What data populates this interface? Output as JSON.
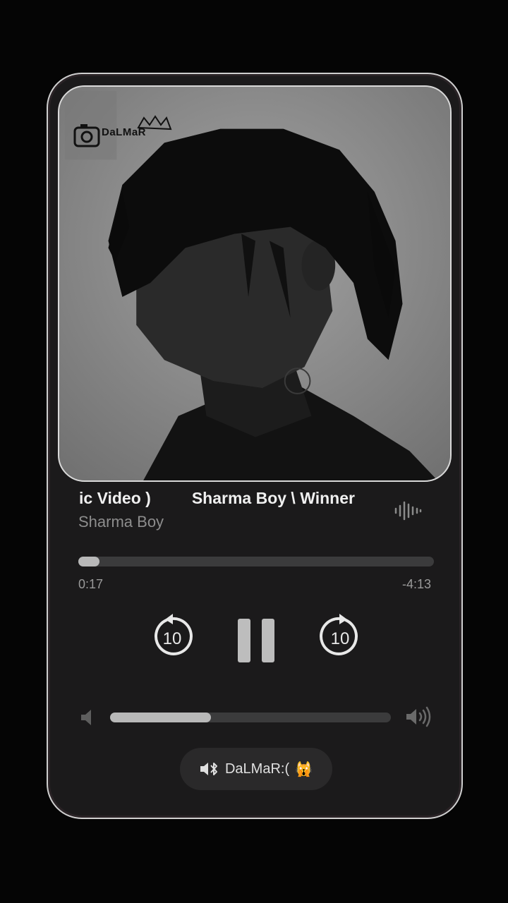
{
  "artwork": {
    "watermark": "DaLMaR"
  },
  "track": {
    "title_part1": "ic Video )",
    "title_part2": "Sharma Boy \\ Winner",
    "artist": "Sharma Boy"
  },
  "progress": {
    "elapsed": "0:17",
    "remaining": "-4:13",
    "fraction": 0.06
  },
  "controls": {
    "skip_back": "10",
    "skip_forward": "10"
  },
  "volume": {
    "level": 0.36
  },
  "output_device": {
    "label": "DaLMaR:(",
    "emoji": "🙀"
  },
  "colors": {
    "card_bg": "#1b1a1b",
    "accent": "#b8b8b8"
  }
}
